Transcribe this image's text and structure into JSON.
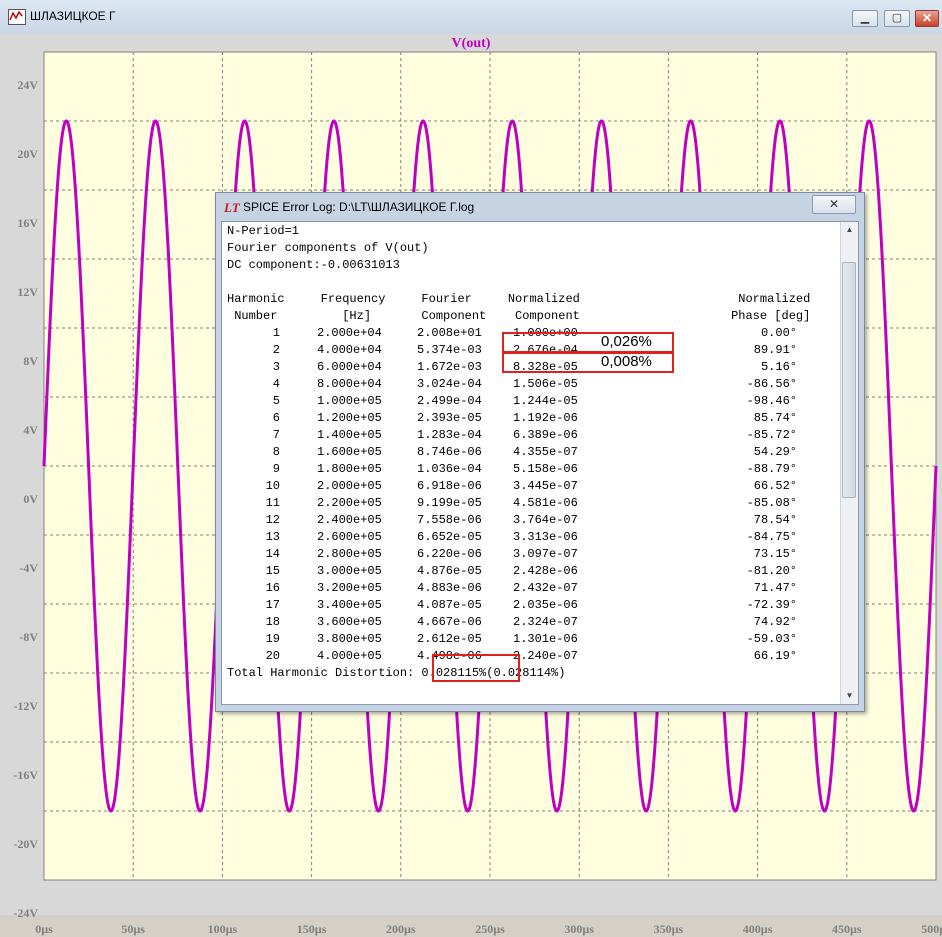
{
  "window": {
    "title": "ШЛАЗИЦКОЕ Г",
    "min_label": "▁",
    "max_label": "▢",
    "close_label": "✕"
  },
  "plot": {
    "trace_name": "V(out)",
    "trace_color": "#c000c0",
    "y_ticks": [
      "24V",
      "20V",
      "16V",
      "12V",
      "8V",
      "4V",
      "0V",
      "-4V",
      "-8V",
      "-12V",
      "-16V",
      "-20V",
      "-24V"
    ],
    "x_ticks": [
      "0µs",
      "50µs",
      "100µs",
      "150µs",
      "200µs",
      "250µs",
      "300µs",
      "350µs",
      "400µs",
      "450µs",
      "500µs"
    ]
  },
  "chart_data": {
    "type": "line",
    "title": "V(out)",
    "xlabel": "",
    "ylabel": "",
    "xlim": [
      0,
      500
    ],
    "x_unit": "µs",
    "ylim": [
      -24,
      24
    ],
    "y_unit": "V",
    "grid": true,
    "series": [
      {
        "name": "V(out)",
        "waveform": "sine",
        "amplitude": 20,
        "frequency_hz": 20000,
        "offset": 0,
        "color": "#c000c0"
      }
    ]
  },
  "log": {
    "title": "SPICE Error Log: D:\\LT\\ШЛАЗИЦКОЕ Г.log",
    "close_label": "✕",
    "line1": "N-Period=1",
    "line2": "Fourier components of V(out)",
    "line3": "DC component:-0.00631013",
    "header1": "Harmonic     Frequency     Fourier     Normalized                      Normalized",
    "header2": " Number         [Hz]       Component    Component                     Phase [deg]",
    "rows": [
      {
        "n": "1",
        "f": "2.000e+04",
        "c": "2.008e+01",
        "nc": "1.000e+00",
        "p": "0.00°"
      },
      {
        "n": "2",
        "f": "4.000e+04",
        "c": "5.374e-03",
        "nc": "2.676e-04",
        "p": "89.91°"
      },
      {
        "n": "3",
        "f": "6.000e+04",
        "c": "1.672e-03",
        "nc": "8.328e-05",
        "p": "5.16°"
      },
      {
        "n": "4",
        "f": "8.000e+04",
        "c": "3.024e-04",
        "nc": "1.506e-05",
        "p": "-86.56°"
      },
      {
        "n": "5",
        "f": "1.000e+05",
        "c": "2.499e-04",
        "nc": "1.244e-05",
        "p": "-98.46°"
      },
      {
        "n": "6",
        "f": "1.200e+05",
        "c": "2.393e-05",
        "nc": "1.192e-06",
        "p": "85.74°"
      },
      {
        "n": "7",
        "f": "1.400e+05",
        "c": "1.283e-04",
        "nc": "6.389e-06",
        "p": "-85.72°"
      },
      {
        "n": "8",
        "f": "1.600e+05",
        "c": "8.746e-06",
        "nc": "4.355e-07",
        "p": "54.29°"
      },
      {
        "n": "9",
        "f": "1.800e+05",
        "c": "1.036e-04",
        "nc": "5.158e-06",
        "p": "-88.79°"
      },
      {
        "n": "10",
        "f": "2.000e+05",
        "c": "6.918e-06",
        "nc": "3.445e-07",
        "p": "66.52°"
      },
      {
        "n": "11",
        "f": "2.200e+05",
        "c": "9.199e-05",
        "nc": "4.581e-06",
        "p": "-85.08°"
      },
      {
        "n": "12",
        "f": "2.400e+05",
        "c": "7.558e-06",
        "nc": "3.764e-07",
        "p": "78.54°"
      },
      {
        "n": "13",
        "f": "2.600e+05",
        "c": "6.652e-05",
        "nc": "3.313e-06",
        "p": "-84.75°"
      },
      {
        "n": "14",
        "f": "2.800e+05",
        "c": "6.220e-06",
        "nc": "3.097e-07",
        "p": "73.15°"
      },
      {
        "n": "15",
        "f": "3.000e+05",
        "c": "4.876e-05",
        "nc": "2.428e-06",
        "p": "-81.20°"
      },
      {
        "n": "16",
        "f": "3.200e+05",
        "c": "4.883e-06",
        "nc": "2.432e-07",
        "p": "71.47°"
      },
      {
        "n": "17",
        "f": "3.400e+05",
        "c": "4.087e-05",
        "nc": "2.035e-06",
        "p": "-72.39°"
      },
      {
        "n": "18",
        "f": "3.600e+05",
        "c": "4.667e-06",
        "nc": "2.324e-07",
        "p": "74.92°"
      },
      {
        "n": "19",
        "f": "3.800e+05",
        "c": "2.612e-05",
        "nc": "1.301e-06",
        "p": "-59.03°"
      },
      {
        "n": "20",
        "f": "4.000e+05",
        "c": "4.498e-06",
        "nc": "2.240e-07",
        "p": "66.19°"
      }
    ],
    "thd_line": "Total Harmonic Distortion: 0.028115%(0.028114%)",
    "annot_h2": "0,026%",
    "annot_h3": "0,008%"
  }
}
